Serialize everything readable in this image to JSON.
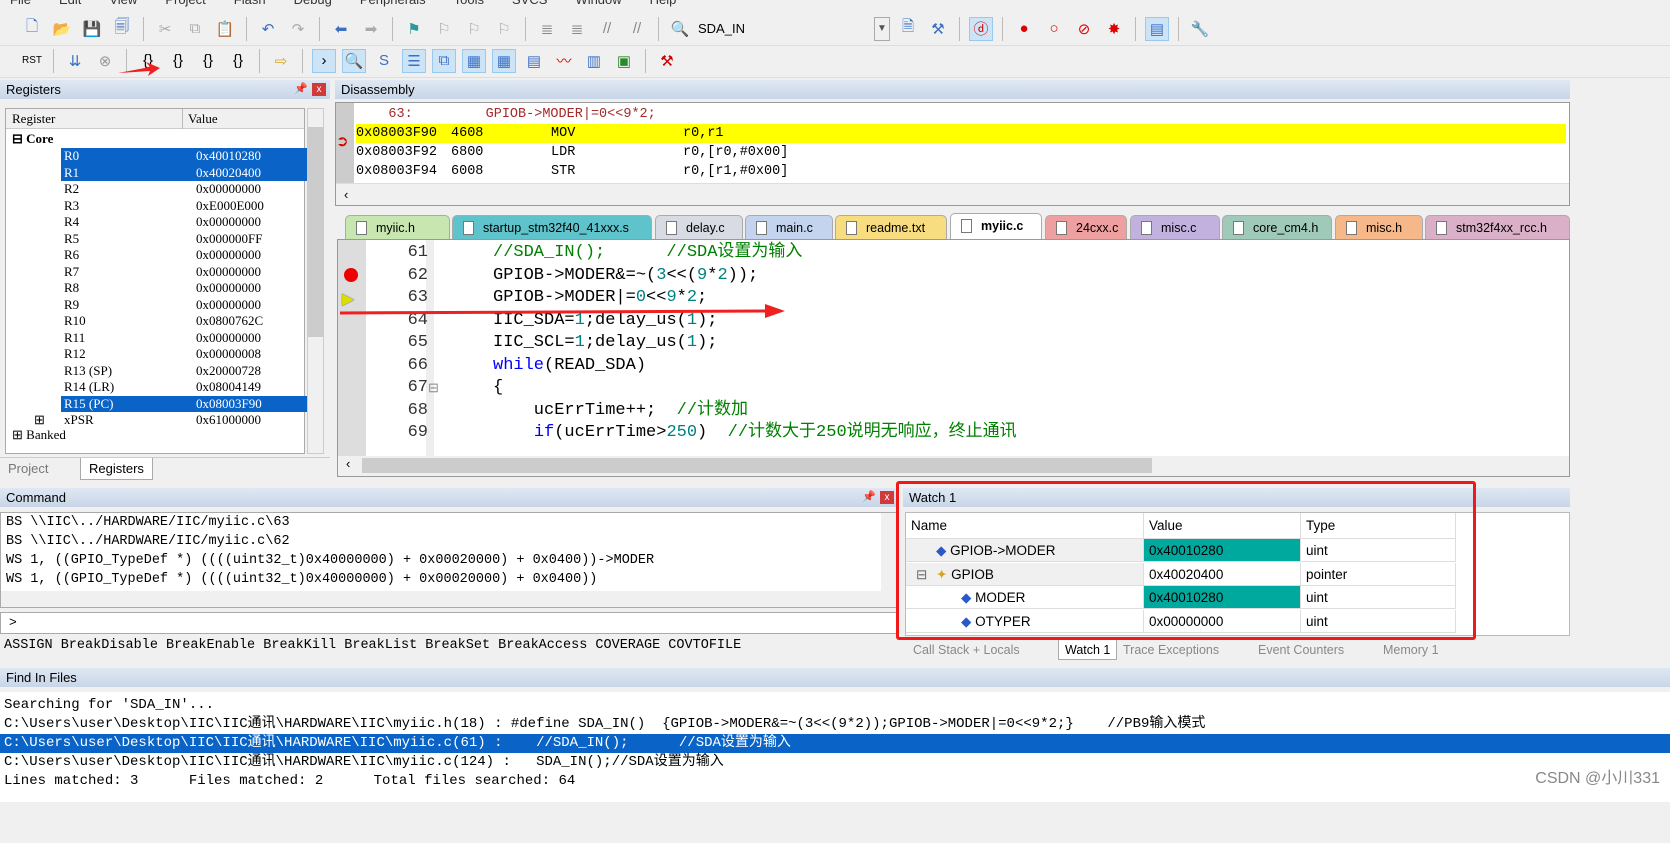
{
  "menu": [
    "File",
    "Edit",
    "View",
    "Project",
    "Flash",
    "Debug",
    "Peripherals",
    "Tools",
    "SVCS",
    "Window",
    "Help"
  ],
  "toolbar": {
    "find_value": "SDA_IN"
  },
  "registers": {
    "title": "Registers",
    "col_register": "Register",
    "col_value": "Value",
    "group_core": "Core",
    "rows": [
      {
        "name": "R0",
        "value": "0x40010280",
        "selected": true
      },
      {
        "name": "R1",
        "value": "0x40020400",
        "selected": true
      },
      {
        "name": "R2",
        "value": "0x00000000"
      },
      {
        "name": "R3",
        "value": "0xE000E000"
      },
      {
        "name": "R4",
        "value": "0x00000000"
      },
      {
        "name": "R5",
        "value": "0x000000FF"
      },
      {
        "name": "R6",
        "value": "0x00000000"
      },
      {
        "name": "R7",
        "value": "0x00000000"
      },
      {
        "name": "R8",
        "value": "0x00000000"
      },
      {
        "name": "R9",
        "value": "0x00000000"
      },
      {
        "name": "R10",
        "value": "0x0800762C"
      },
      {
        "name": "R11",
        "value": "0x00000000"
      },
      {
        "name": "R12",
        "value": "0x00000008"
      },
      {
        "name": "R13 (SP)",
        "value": "0x20000728"
      },
      {
        "name": "R14 (LR)",
        "value": "0x08004149"
      },
      {
        "name": "R15 (PC)",
        "value": "0x08003F90",
        "selected": true
      },
      {
        "name": "xPSR",
        "value": "0x61000000"
      }
    ],
    "group_banked": "Banked",
    "tabs": [
      "Project",
      "Registers"
    ]
  },
  "disassembly": {
    "title": "Disassembly",
    "source_line": "    63:         GPIOB->MODER|=0<<9*2;",
    "lines": [
      {
        "addr": "0x08003F90",
        "code": "4608",
        "op": "MOV",
        "args": "r0,r1",
        "current": true
      },
      {
        "addr": "0x08003F92",
        "code": "6800",
        "op": "LDR",
        "args": "r0,[r0,#0x00]"
      },
      {
        "addr": "0x08003F94",
        "code": "6008",
        "op": "STR",
        "args": "r0,[r1,#0x00]"
      }
    ]
  },
  "editor": {
    "tabs": [
      {
        "label": "myiic.h",
        "color": "#c8e6b0"
      },
      {
        "label": "startup_stm32f40_41xxx.s",
        "color": "#5fc3cc"
      },
      {
        "label": "delay.c",
        "color": "#d8dbe3"
      },
      {
        "label": "main.c",
        "color": "#c4d4ee"
      },
      {
        "label": "readme.txt",
        "color": "#f7dc80"
      },
      {
        "label": "myiic.c",
        "color": "#c7d8b0",
        "active": true
      },
      {
        "label": "24cxx.c",
        "color": "#ee9f9f"
      },
      {
        "label": "misc.c",
        "color": "#c2b1de"
      },
      {
        "label": "core_cm4.h",
        "color": "#9fc9b8"
      },
      {
        "label": "misc.h",
        "color": "#f6b888"
      },
      {
        "label": "stm32f4xx_rcc.h",
        "color": "#dab0c8"
      }
    ],
    "lines": [
      {
        "n": "61",
        "seg": [
          [
            "cm",
            "//SDA_IN();      //SDA设置为输入"
          ]
        ]
      },
      {
        "n": "62",
        "seg": [
          [
            "tx",
            "GPIOB->MODER&=~("
          ],
          [
            "num",
            "3"
          ],
          [
            "tx",
            "<<("
          ],
          [
            "num",
            "9"
          ],
          [
            "tx",
            "*"
          ],
          [
            "num",
            "2"
          ],
          [
            "tx",
            "));"
          ]
        ]
      },
      {
        "n": "63",
        "seg": [
          [
            "tx",
            "GPIOB->MODER|="
          ],
          [
            "num",
            "0"
          ],
          [
            "tx",
            "<<"
          ],
          [
            "num",
            "9"
          ],
          [
            "tx",
            "*"
          ],
          [
            "num",
            "2"
          ],
          [
            "tx",
            ";"
          ]
        ]
      },
      {
        "n": "64",
        "seg": [
          [
            "tx",
            "IIC_SDA="
          ],
          [
            "num",
            "1"
          ],
          [
            "tx",
            ";delay_us("
          ],
          [
            "num",
            "1"
          ],
          [
            "tx",
            ");"
          ]
        ]
      },
      {
        "n": "65",
        "seg": [
          [
            "tx",
            "IIC_SCL="
          ],
          [
            "num",
            "1"
          ],
          [
            "tx",
            ";delay_us("
          ],
          [
            "num",
            "1"
          ],
          [
            "tx",
            ");"
          ]
        ]
      },
      {
        "n": "66",
        "seg": [
          [
            "kw",
            "while"
          ],
          [
            "tx",
            "(READ_SDA)"
          ]
        ]
      },
      {
        "n": "67",
        "seg": [
          [
            "tx",
            "{"
          ]
        ]
      },
      {
        "n": "68",
        "seg": [
          [
            "tx",
            "    ucErrTime++;  "
          ],
          [
            "cm",
            "//计数加"
          ]
        ]
      },
      {
        "n": "69",
        "seg": [
          [
            "tx",
            "    "
          ],
          [
            "kw",
            "if"
          ],
          [
            "tx",
            "(ucErrTime>"
          ],
          [
            "num",
            "250"
          ],
          [
            "tx",
            ")  "
          ],
          [
            "cm",
            "//计数大于250说明无响应，终止通讯"
          ]
        ]
      }
    ]
  },
  "command": {
    "title": "Command",
    "lines": [
      "BS \\\\IIC\\../HARDWARE/IIC/myiic.c\\63",
      "BS \\\\IIC\\../HARDWARE/IIC/myiic.c\\62",
      "WS 1, ((GPIO_TypeDef *) ((((uint32_t)0x40000000) + 0x00020000) + 0x0400))->MODER",
      "WS 1, ((GPIO_TypeDef *) ((((uint32_t)0x40000000) + 0x00020000) + 0x0400))"
    ],
    "prompt": ">",
    "hints": "ASSIGN BreakDisable BreakEnable BreakKill BreakList BreakSet BreakAccess COVERAGE COVTOFILE"
  },
  "watch": {
    "title": "Watch 1",
    "col_name": "Name",
    "col_value": "Value",
    "col_type": "Type",
    "rows": [
      {
        "name": "GPIOB->MODER",
        "value": "0x40010280",
        "type": "uint",
        "changed": true
      },
      {
        "name": "GPIOB",
        "value": "0x40020400",
        "type": "pointer"
      },
      {
        "name": "MODER",
        "value": "0x40010280",
        "type": "uint",
        "changed": true
      },
      {
        "name": "OTYPER",
        "value": "0x00000000",
        "type": "uint"
      }
    ],
    "tabs": [
      "Call Stack + Locals",
      "Watch 1",
      "Trace Exceptions",
      "Event Counters",
      "Memory 1"
    ],
    "changed_color": "#00a99d"
  },
  "find": {
    "title": "Find In Files",
    "lines": [
      "Searching for 'SDA_IN'...",
      "C:\\Users\\user\\Desktop\\IIC\\IIC通讯\\HARDWARE\\IIC\\myiic.h(18) : #define SDA_IN()  {GPIOB->MODER&=~(3<<(9*2));GPIOB->MODER|=0<<9*2;}    //PB9输入模式",
      "C:\\Users\\user\\Desktop\\IIC\\IIC通讯\\HARDWARE\\IIC\\myiic.c(61) :    //SDA_IN();      //SDA设置为输入",
      "C:\\Users\\user\\Desktop\\IIC\\IIC通讯\\HARDWARE\\IIC\\myiic.c(124) :   SDA_IN();//SDA设置为输入",
      "Lines matched: 3      Files matched: 2      Total files searched: 64"
    ]
  },
  "watermark": "CSDN @小川331"
}
